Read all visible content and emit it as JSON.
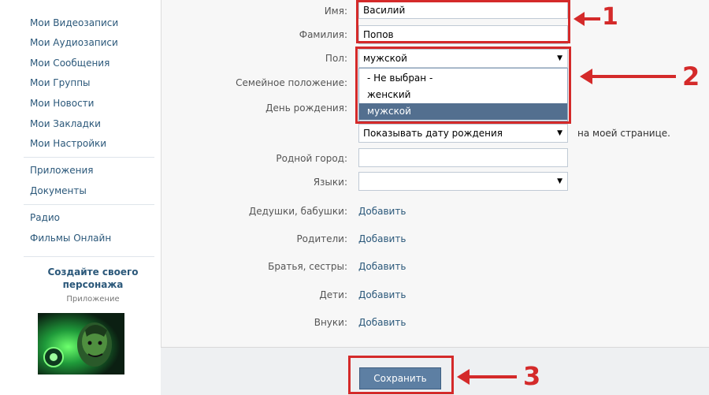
{
  "sidebar": {
    "items": [
      {
        "label": "Мои Видеозаписи"
      },
      {
        "label": "Мои Аудиозаписи"
      },
      {
        "label": "Мои Сообщения"
      },
      {
        "label": "Мои Группы"
      },
      {
        "label": "Мои Новости"
      },
      {
        "label": "Мои Закладки"
      },
      {
        "label": "Мои Настройки"
      },
      {
        "label": "Приложения"
      },
      {
        "label": "Документы"
      },
      {
        "label": "Радио"
      },
      {
        "label": "Фильмы Онлайн"
      }
    ],
    "promo": {
      "title": "Создайте своего персонажа",
      "subtitle": "Приложение",
      "image_icon": "game-character-image"
    }
  },
  "form": {
    "first_name": {
      "label": "Имя:",
      "value": "Василий"
    },
    "last_name": {
      "label": "Фамилия:",
      "value": "Попов"
    },
    "gender": {
      "label": "Пол:",
      "value": "мужской",
      "options": [
        "- Не выбран -",
        "женский",
        "мужской"
      ],
      "selected_index": 2
    },
    "marital_status": {
      "label": "Семейное положение:"
    },
    "birthday": {
      "label": "День рождения:",
      "visibility_value": "Показывать дату рождения",
      "visibility_suffix": "на моей странице."
    },
    "hometown": {
      "label": "Родной город:",
      "value": ""
    },
    "languages": {
      "label": "Языки:",
      "value": ""
    },
    "relatives": [
      {
        "label": "Дедушки, бабушки:",
        "action": "Добавить"
      },
      {
        "label": "Родители:",
        "action": "Добавить"
      },
      {
        "label": "Братья, сестры:",
        "action": "Добавить"
      },
      {
        "label": "Дети:",
        "action": "Добавить"
      },
      {
        "label": "Внуки:",
        "action": "Добавить"
      }
    ],
    "save_label": "Сохранить"
  },
  "annotations": {
    "n1": "1",
    "n2": "2",
    "n3": "3",
    "color": "#d42a2a"
  },
  "colors": {
    "link": "#2b587a",
    "button": "#5d7fa3",
    "dropdown_selected": "#536f8f"
  }
}
